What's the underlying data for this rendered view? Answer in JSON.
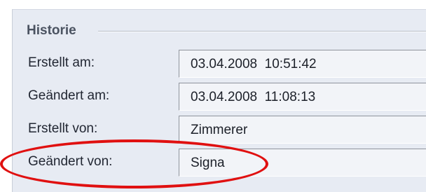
{
  "historie": {
    "title": "Historie",
    "rows": [
      {
        "label": "Erstellt am:",
        "value": "03.04.2008  10:51:42"
      },
      {
        "label": "Geändert am:",
        "value": "03.04.2008  11:08:13"
      },
      {
        "label": "Erstellt von:",
        "value": "Zimmerer"
      },
      {
        "label": "Geändert von:",
        "value": "Signa"
      }
    ]
  },
  "colors": {
    "panel_background": "#e7ebf3",
    "highlight": "#e01010"
  }
}
